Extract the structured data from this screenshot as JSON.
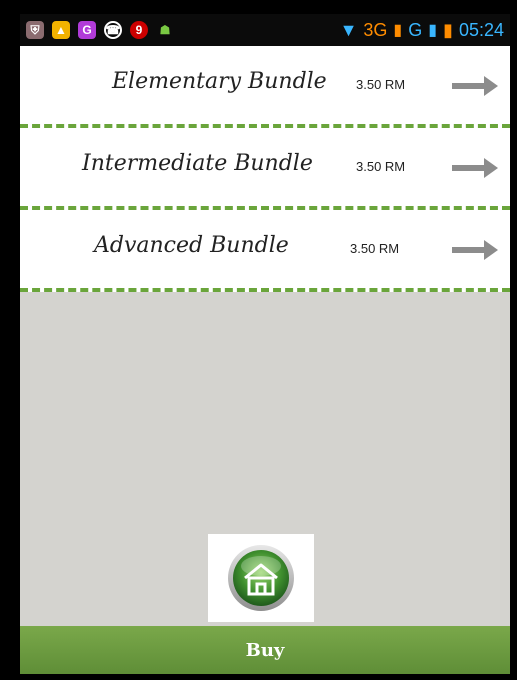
{
  "status_bar": {
    "time": "05:24",
    "network_label": "3G",
    "network_label2": "G",
    "icons": [
      "notification-icon",
      "photo-icon",
      "g-app-icon",
      "whatsapp-icon",
      "badge-icon",
      "android-icon",
      "wifi-icon",
      "signal-icon",
      "battery-icon"
    ],
    "badge_count": "9"
  },
  "bundles": [
    {
      "title": "Elementary Bundle",
      "price": "3.50 RM"
    },
    {
      "title": "Intermediate Bundle",
      "price": "3.50 RM"
    },
    {
      "title": "Advanced Bundle",
      "price": "3.50 RM"
    }
  ],
  "actions": {
    "buy_label": "Buy"
  },
  "colors": {
    "accent_green": "#6aa53b",
    "buy_bar": "#6f9e43",
    "arrow_gray": "#8c8c8c"
  }
}
